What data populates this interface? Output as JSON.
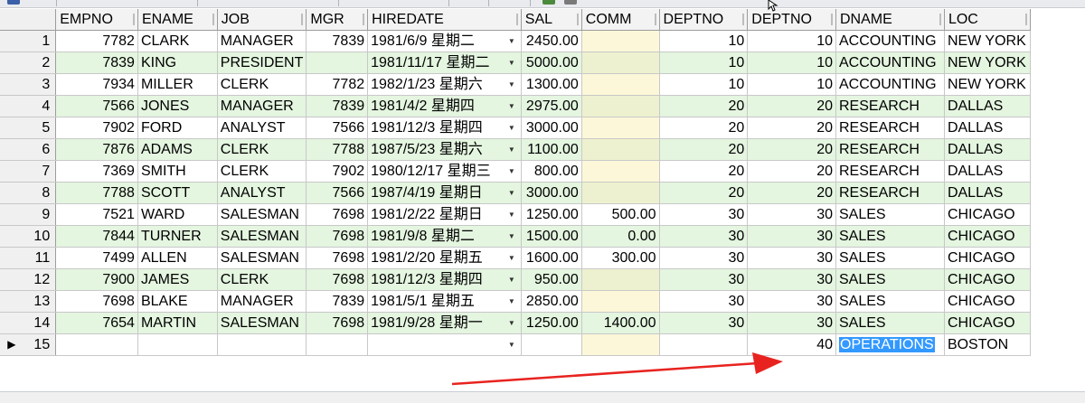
{
  "grid": {
    "columns": [
      {
        "label": "EMPNO"
      },
      {
        "label": "ENAME"
      },
      {
        "label": "JOB"
      },
      {
        "label": "MGR"
      },
      {
        "label": "HIREDATE"
      },
      {
        "label": "SAL"
      },
      {
        "label": "COMM"
      },
      {
        "label": "DEPTNO"
      },
      {
        "label": "DEPTNO"
      },
      {
        "label": "DNAME"
      },
      {
        "label": "LOC"
      }
    ],
    "rows": [
      {
        "n": "1",
        "empno": "7782",
        "ename": "CLARK",
        "job": "MANAGER",
        "mgr": "7839",
        "hiredate": "1981/6/9 星期二",
        "sal": "2450.00",
        "comm": "",
        "deptno": "10",
        "deptno2": "10",
        "dname": "ACCOUNTING",
        "loc": "NEW YORK"
      },
      {
        "n": "2",
        "empno": "7839",
        "ename": "KING",
        "job": "PRESIDENT",
        "mgr": "",
        "hiredate": "1981/11/17 星期二",
        "sal": "5000.00",
        "comm": "",
        "deptno": "10",
        "deptno2": "10",
        "dname": "ACCOUNTING",
        "loc": "NEW YORK"
      },
      {
        "n": "3",
        "empno": "7934",
        "ename": "MILLER",
        "job": "CLERK",
        "mgr": "7782",
        "hiredate": "1982/1/23 星期六",
        "sal": "1300.00",
        "comm": "",
        "deptno": "10",
        "deptno2": "10",
        "dname": "ACCOUNTING",
        "loc": "NEW YORK"
      },
      {
        "n": "4",
        "empno": "7566",
        "ename": "JONES",
        "job": "MANAGER",
        "mgr": "7839",
        "hiredate": "1981/4/2 星期四",
        "sal": "2975.00",
        "comm": "",
        "deptno": "20",
        "deptno2": "20",
        "dname": "RESEARCH",
        "loc": "DALLAS"
      },
      {
        "n": "5",
        "empno": "7902",
        "ename": "FORD",
        "job": "ANALYST",
        "mgr": "7566",
        "hiredate": "1981/12/3 星期四",
        "sal": "3000.00",
        "comm": "",
        "deptno": "20",
        "deptno2": "20",
        "dname": "RESEARCH",
        "loc": "DALLAS"
      },
      {
        "n": "6",
        "empno": "7876",
        "ename": "ADAMS",
        "job": "CLERK",
        "mgr": "7788",
        "hiredate": "1987/5/23 星期六",
        "sal": "1100.00",
        "comm": "",
        "deptno": "20",
        "deptno2": "20",
        "dname": "RESEARCH",
        "loc": "DALLAS"
      },
      {
        "n": "7",
        "empno": "7369",
        "ename": "SMITH",
        "job": "CLERK",
        "mgr": "7902",
        "hiredate": "1980/12/17 星期三",
        "sal": "800.00",
        "comm": "",
        "deptno": "20",
        "deptno2": "20",
        "dname": "RESEARCH",
        "loc": "DALLAS"
      },
      {
        "n": "8",
        "empno": "7788",
        "ename": "SCOTT",
        "job": "ANALYST",
        "mgr": "7566",
        "hiredate": "1987/4/19 星期日",
        "sal": "3000.00",
        "comm": "",
        "deptno": "20",
        "deptno2": "20",
        "dname": "RESEARCH",
        "loc": "DALLAS"
      },
      {
        "n": "9",
        "empno": "7521",
        "ename": "WARD",
        "job": "SALESMAN",
        "mgr": "7698",
        "hiredate": "1981/2/22 星期日",
        "sal": "1250.00",
        "comm": "500.00",
        "deptno": "30",
        "deptno2": "30",
        "dname": "SALES",
        "loc": "CHICAGO"
      },
      {
        "n": "10",
        "empno": "7844",
        "ename": "TURNER",
        "job": "SALESMAN",
        "mgr": "7698",
        "hiredate": "1981/9/8 星期二",
        "sal": "1500.00",
        "comm": "0.00",
        "deptno": "30",
        "deptno2": "30",
        "dname": "SALES",
        "loc": "CHICAGO"
      },
      {
        "n": "11",
        "empno": "7499",
        "ename": "ALLEN",
        "job": "SALESMAN",
        "mgr": "7698",
        "hiredate": "1981/2/20 星期五",
        "sal": "1600.00",
        "comm": "300.00",
        "deptno": "30",
        "deptno2": "30",
        "dname": "SALES",
        "loc": "CHICAGO"
      },
      {
        "n": "12",
        "empno": "7900",
        "ename": "JAMES",
        "job": "CLERK",
        "mgr": "7698",
        "hiredate": "1981/12/3 星期四",
        "sal": "950.00",
        "comm": "",
        "deptno": "30",
        "deptno2": "30",
        "dname": "SALES",
        "loc": "CHICAGO"
      },
      {
        "n": "13",
        "empno": "7698",
        "ename": "BLAKE",
        "job": "MANAGER",
        "mgr": "7839",
        "hiredate": "1981/5/1 星期五",
        "sal": "2850.00",
        "comm": "",
        "deptno": "30",
        "deptno2": "30",
        "dname": "SALES",
        "loc": "CHICAGO"
      },
      {
        "n": "14",
        "empno": "7654",
        "ename": "MARTIN",
        "job": "SALESMAN",
        "mgr": "7698",
        "hiredate": "1981/9/28 星期一",
        "sal": "1250.00",
        "comm": "1400.00",
        "deptno": "30",
        "deptno2": "30",
        "dname": "SALES",
        "loc": "CHICAGO"
      },
      {
        "n": "15",
        "empno": "",
        "ename": "",
        "job": "",
        "mgr": "",
        "hiredate": "",
        "sal": "",
        "comm": "",
        "deptno": "",
        "deptno2": "40",
        "dname": "OPERATIONS",
        "loc": "BOSTON"
      }
    ],
    "current_row_indicator": "▶",
    "dropdown_glyph": "▼",
    "selected_cell": "OPERATIONS"
  },
  "colors": {
    "even_row": "#e4f5e0",
    "empty_comm": "#fbf7d8",
    "selection": "#3399ff",
    "annotation_arrow": "#e8231f"
  },
  "icons": {
    "row_indicator": "current-row-arrow-icon",
    "dropdown": "chevron-down-icon",
    "annotation": "red-arrow-annotation",
    "cursor": "mouse-pointer-icon"
  }
}
